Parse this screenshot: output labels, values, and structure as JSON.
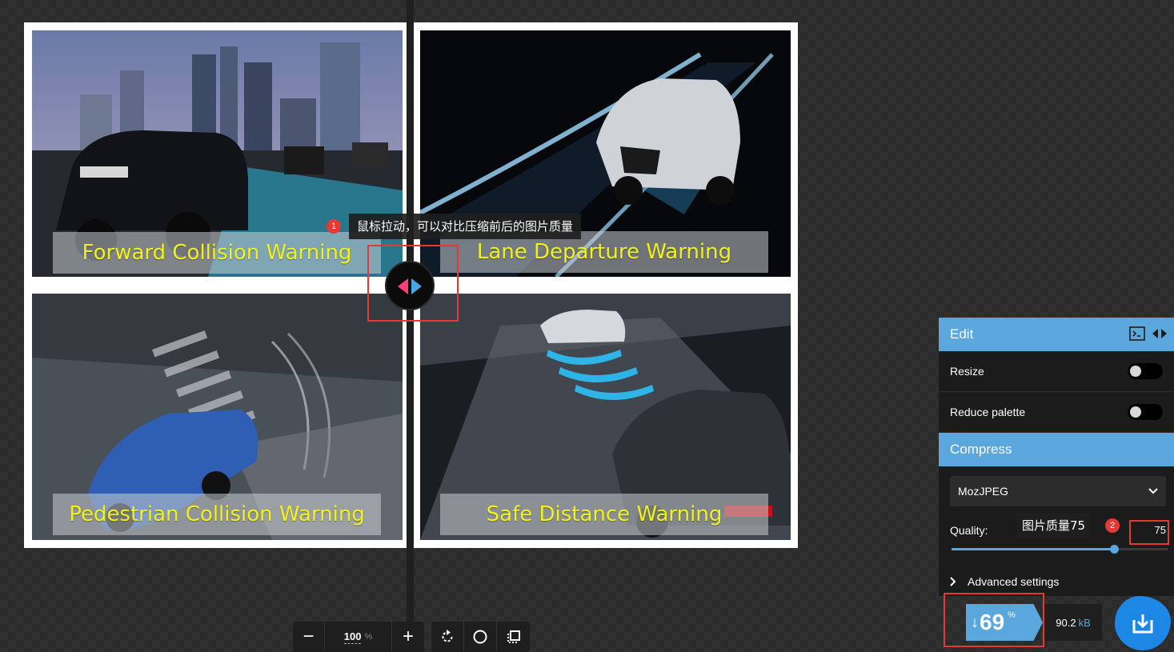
{
  "tiles": [
    {
      "caption": "Forward Collision Warning"
    },
    {
      "caption": "Lane Departure Warning"
    },
    {
      "caption": "Pedestrian Collision Warning"
    },
    {
      "caption": "Safe Distance Warning"
    }
  ],
  "annotations": {
    "tip1": {
      "badge": "1",
      "text": "鼠标拉动，可以对比压缩前后的图片质量"
    },
    "tip2": {
      "badge": "2",
      "text": "图片质量75"
    }
  },
  "zoom": {
    "minus": "−",
    "value": "100",
    "unit": "%",
    "plus": "+"
  },
  "panel": {
    "edit": {
      "title": "Edit",
      "resize_label": "Resize",
      "resize_on": false,
      "reduce_palette_label": "Reduce palette",
      "reduce_palette_on": false
    },
    "compress": {
      "title": "Compress",
      "codec": "MozJPEG",
      "quality_label": "Quality:",
      "quality_value": "75",
      "quality_fraction": 0.75,
      "advanced_label": "Advanced settings"
    }
  },
  "result": {
    "arrow": "↓",
    "percent": "69",
    "percent_symbol": "%",
    "size_value": "90.2",
    "size_unit": "kB"
  },
  "colors": {
    "accent": "#5aa7dd",
    "highlight": "#e53935",
    "caption_text": "#f2f21a",
    "download": "#1c87e5"
  },
  "icons": [
    "minus-icon",
    "plus-icon",
    "rotate-icon",
    "circle-icon",
    "crop-icon",
    "terminal-icon",
    "swap-icon",
    "chevron-down-icon",
    "chevron-right-icon",
    "download-icon"
  ]
}
